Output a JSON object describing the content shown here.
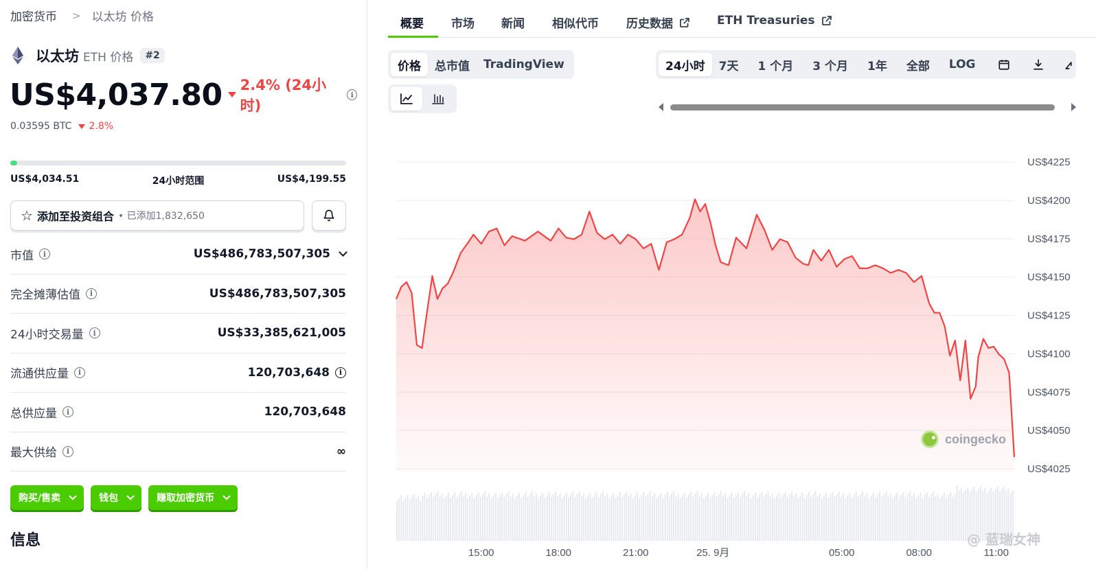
{
  "breadcrumb": {
    "root": "加密货币",
    "current": "以太坊 价格"
  },
  "coin": {
    "name": "以太坊",
    "symbol_label": "ETH 价格",
    "rank": "#2"
  },
  "price": {
    "value": "US$4,037.80",
    "change": "2.4% (24小时)",
    "btc_value": "0.03595 BTC",
    "btc_change": "2.8%"
  },
  "range": {
    "low": "US$4,034.51",
    "label": "24小时范围",
    "high": "US$4,199.55",
    "position": 0.02
  },
  "portfolio": {
    "label": "添加至投资组合",
    "added": "• 已添加1,832,650"
  },
  "stats": [
    {
      "label": "市值",
      "value": "US$486,783,507,305"
    },
    {
      "label": "完全摊薄估值",
      "value": "US$486,783,507,305"
    },
    {
      "label": "24小时交易量",
      "value": "US$33,385,621,005"
    },
    {
      "label": "流通供应量",
      "value": "120,703,648"
    },
    {
      "label": "总供应量",
      "value": "120,703,648"
    },
    {
      "label": "最大供给",
      "value": "∞"
    }
  ],
  "actions": {
    "buy_sell": "购买/售卖",
    "wallet": "钱包",
    "earn": "赚取加密货币"
  },
  "info_title": "信息",
  "tabs": [
    "概要",
    "市场",
    "新闻",
    "相似代币",
    "历史数据",
    "ETH Treasuries"
  ],
  "chart_tabs": [
    "价格",
    "总市值",
    "TradingView"
  ],
  "time_ranges": [
    "24小时",
    "7天",
    "1 个月",
    "3 个月",
    "1年",
    "全部",
    "LOG"
  ],
  "watermark": "coingecko",
  "social_watermark": "@ 蓝瑞女神",
  "colors": {
    "accent": "#4bcc00",
    "down": "#ef4444"
  },
  "chart_data": {
    "type": "area",
    "series_color": "#ef4444",
    "y_ticks": [
      "US$4225",
      "US$4200",
      "US$4175",
      "US$4150",
      "US$4125",
      "US$4100",
      "US$4075",
      "US$4050",
      "US$4025"
    ],
    "ylim": [
      4025,
      4225
    ],
    "x_ticks": [
      "15:00",
      "18:00",
      "21:00",
      "25. 9月",
      "05:00",
      "08:00",
      "11:00"
    ],
    "x_tick_hours": [
      3.3,
      6.3,
      9.3,
      12.3,
      17.3,
      20.3,
      23.3
    ],
    "grid": true,
    "x_hours": [
      0,
      0.2,
      0.4,
      0.6,
      0.8,
      1.0,
      1.2,
      1.4,
      1.6,
      1.8,
      2.0,
      2.2,
      2.5,
      2.8,
      3.0,
      3.3,
      3.6,
      3.9,
      4.2,
      4.5,
      5.0,
      5.5,
      6.0,
      6.3,
      6.6,
      6.9,
      7.2,
      7.5,
      7.8,
      8.1,
      8.4,
      8.7,
      9.0,
      9.3,
      9.6,
      9.9,
      10.2,
      10.5,
      10.8,
      11.1,
      11.4,
      11.6,
      11.8,
      12.0,
      12.2,
      12.4,
      12.6,
      12.9,
      13.2,
      13.6,
      14.0,
      14.3,
      14.6,
      14.9,
      15.2,
      15.5,
      15.8,
      16.0,
      16.2,
      16.5,
      16.8,
      17.1,
      17.4,
      17.7,
      18.0,
      18.3,
      18.6,
      18.9,
      19.2,
      19.5,
      19.8,
      20.1,
      20.4,
      20.7,
      20.9,
      21.1,
      21.3,
      21.5,
      21.7,
      21.9,
      22.1,
      22.3,
      22.5,
      22.6,
      22.8,
      23.0,
      23.2,
      23.4,
      23.6,
      23.8,
      24.0
    ],
    "price": [
      4133,
      4141,
      4144,
      4137,
      4103,
      4101,
      4125,
      4148,
      4133,
      4140,
      4143,
      4150,
      4163,
      4170,
      4175,
      4169,
      4177,
      4179,
      4168,
      4174,
      4171,
      4177,
      4171,
      4179,
      4173,
      4172,
      4175,
      4190,
      4176,
      4172,
      4175,
      4169,
      4175,
      4172,
      4166,
      4169,
      4152,
      4170,
      4172,
      4175,
      4186,
      4198,
      4190,
      4195,
      4183,
      4168,
      4157,
      4155,
      4173,
      4166,
      4188,
      4178,
      4165,
      4172,
      4170,
      4160,
      4156,
      4155,
      4165,
      4158,
      4165,
      4154,
      4159,
      4161,
      4153,
      4153,
      4155,
      4153,
      4150,
      4152,
      4150,
      4144,
      4148,
      4130,
      4124,
      4124,
      4115,
      4096,
      4106,
      4080,
      4106,
      4068,
      4076,
      4095,
      4107,
      4101,
      4102,
      4097,
      4094,
      4085,
      4030
    ]
  }
}
